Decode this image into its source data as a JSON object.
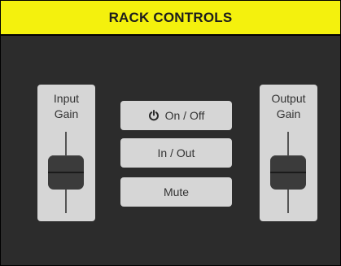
{
  "panel": {
    "title": "RACK CONTROLS",
    "colors": {
      "title_bar": "#f4f10d",
      "background": "#2c2c2c",
      "control_face": "#d6d6d6",
      "knob": "#3b3b3b"
    }
  },
  "input_fader": {
    "label": "Input\nGain",
    "level_fraction": 0.5
  },
  "output_fader": {
    "label": "Output\nGain",
    "level_fraction": 0.5
  },
  "buttons": {
    "on_off": {
      "label": "On / Off",
      "icon": "power-icon"
    },
    "in_out": {
      "label": "In / Out"
    },
    "mute": {
      "label": "Mute"
    }
  }
}
